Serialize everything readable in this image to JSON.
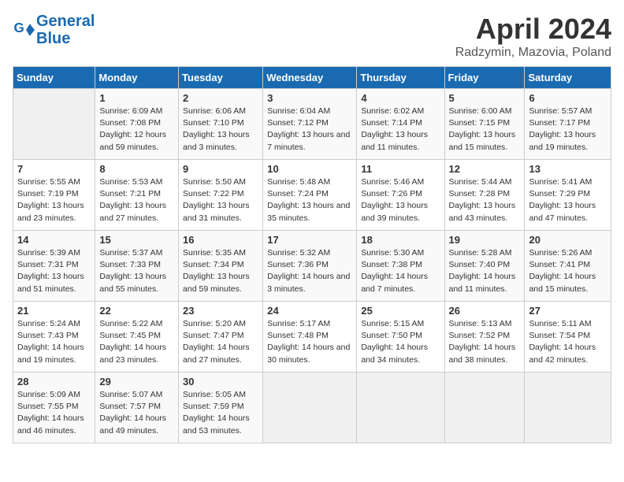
{
  "logo": {
    "line1": "General",
    "line2": "Blue"
  },
  "title": "April 2024",
  "subtitle": "Radzymin, Mazovia, Poland",
  "header": {
    "days": [
      "Sunday",
      "Monday",
      "Tuesday",
      "Wednesday",
      "Thursday",
      "Friday",
      "Saturday"
    ]
  },
  "weeks": [
    [
      {
        "day": "",
        "sunrise": "",
        "sunset": "",
        "daylight": "",
        "empty": true
      },
      {
        "day": "1",
        "sunrise": "Sunrise: 6:09 AM",
        "sunset": "Sunset: 7:08 PM",
        "daylight": "Daylight: 12 hours and 59 minutes."
      },
      {
        "day": "2",
        "sunrise": "Sunrise: 6:06 AM",
        "sunset": "Sunset: 7:10 PM",
        "daylight": "Daylight: 13 hours and 3 minutes."
      },
      {
        "day": "3",
        "sunrise": "Sunrise: 6:04 AM",
        "sunset": "Sunset: 7:12 PM",
        "daylight": "Daylight: 13 hours and 7 minutes."
      },
      {
        "day": "4",
        "sunrise": "Sunrise: 6:02 AM",
        "sunset": "Sunset: 7:14 PM",
        "daylight": "Daylight: 13 hours and 11 minutes."
      },
      {
        "day": "5",
        "sunrise": "Sunrise: 6:00 AM",
        "sunset": "Sunset: 7:15 PM",
        "daylight": "Daylight: 13 hours and 15 minutes."
      },
      {
        "day": "6",
        "sunrise": "Sunrise: 5:57 AM",
        "sunset": "Sunset: 7:17 PM",
        "daylight": "Daylight: 13 hours and 19 minutes."
      }
    ],
    [
      {
        "day": "7",
        "sunrise": "Sunrise: 5:55 AM",
        "sunset": "Sunset: 7:19 PM",
        "daylight": "Daylight: 13 hours and 23 minutes."
      },
      {
        "day": "8",
        "sunrise": "Sunrise: 5:53 AM",
        "sunset": "Sunset: 7:21 PM",
        "daylight": "Daylight: 13 hours and 27 minutes."
      },
      {
        "day": "9",
        "sunrise": "Sunrise: 5:50 AM",
        "sunset": "Sunset: 7:22 PM",
        "daylight": "Daylight: 13 hours and 31 minutes."
      },
      {
        "day": "10",
        "sunrise": "Sunrise: 5:48 AM",
        "sunset": "Sunset: 7:24 PM",
        "daylight": "Daylight: 13 hours and 35 minutes."
      },
      {
        "day": "11",
        "sunrise": "Sunrise: 5:46 AM",
        "sunset": "Sunset: 7:26 PM",
        "daylight": "Daylight: 13 hours and 39 minutes."
      },
      {
        "day": "12",
        "sunrise": "Sunrise: 5:44 AM",
        "sunset": "Sunset: 7:28 PM",
        "daylight": "Daylight: 13 hours and 43 minutes."
      },
      {
        "day": "13",
        "sunrise": "Sunrise: 5:41 AM",
        "sunset": "Sunset: 7:29 PM",
        "daylight": "Daylight: 13 hours and 47 minutes."
      }
    ],
    [
      {
        "day": "14",
        "sunrise": "Sunrise: 5:39 AM",
        "sunset": "Sunset: 7:31 PM",
        "daylight": "Daylight: 13 hours and 51 minutes."
      },
      {
        "day": "15",
        "sunrise": "Sunrise: 5:37 AM",
        "sunset": "Sunset: 7:33 PM",
        "daylight": "Daylight: 13 hours and 55 minutes."
      },
      {
        "day": "16",
        "sunrise": "Sunrise: 5:35 AM",
        "sunset": "Sunset: 7:34 PM",
        "daylight": "Daylight: 13 hours and 59 minutes."
      },
      {
        "day": "17",
        "sunrise": "Sunrise: 5:32 AM",
        "sunset": "Sunset: 7:36 PM",
        "daylight": "Daylight: 14 hours and 3 minutes."
      },
      {
        "day": "18",
        "sunrise": "Sunrise: 5:30 AM",
        "sunset": "Sunset: 7:38 PM",
        "daylight": "Daylight: 14 hours and 7 minutes."
      },
      {
        "day": "19",
        "sunrise": "Sunrise: 5:28 AM",
        "sunset": "Sunset: 7:40 PM",
        "daylight": "Daylight: 14 hours and 11 minutes."
      },
      {
        "day": "20",
        "sunrise": "Sunrise: 5:26 AM",
        "sunset": "Sunset: 7:41 PM",
        "daylight": "Daylight: 14 hours and 15 minutes."
      }
    ],
    [
      {
        "day": "21",
        "sunrise": "Sunrise: 5:24 AM",
        "sunset": "Sunset: 7:43 PM",
        "daylight": "Daylight: 14 hours and 19 minutes."
      },
      {
        "day": "22",
        "sunrise": "Sunrise: 5:22 AM",
        "sunset": "Sunset: 7:45 PM",
        "daylight": "Daylight: 14 hours and 23 minutes."
      },
      {
        "day": "23",
        "sunrise": "Sunrise: 5:20 AM",
        "sunset": "Sunset: 7:47 PM",
        "daylight": "Daylight: 14 hours and 27 minutes."
      },
      {
        "day": "24",
        "sunrise": "Sunrise: 5:17 AM",
        "sunset": "Sunset: 7:48 PM",
        "daylight": "Daylight: 14 hours and 30 minutes."
      },
      {
        "day": "25",
        "sunrise": "Sunrise: 5:15 AM",
        "sunset": "Sunset: 7:50 PM",
        "daylight": "Daylight: 14 hours and 34 minutes."
      },
      {
        "day": "26",
        "sunrise": "Sunrise: 5:13 AM",
        "sunset": "Sunset: 7:52 PM",
        "daylight": "Daylight: 14 hours and 38 minutes."
      },
      {
        "day": "27",
        "sunrise": "Sunrise: 5:11 AM",
        "sunset": "Sunset: 7:54 PM",
        "daylight": "Daylight: 14 hours and 42 minutes."
      }
    ],
    [
      {
        "day": "28",
        "sunrise": "Sunrise: 5:09 AM",
        "sunset": "Sunset: 7:55 PM",
        "daylight": "Daylight: 14 hours and 46 minutes."
      },
      {
        "day": "29",
        "sunrise": "Sunrise: 5:07 AM",
        "sunset": "Sunset: 7:57 PM",
        "daylight": "Daylight: 14 hours and 49 minutes."
      },
      {
        "day": "30",
        "sunrise": "Sunrise: 5:05 AM",
        "sunset": "Sunset: 7:59 PM",
        "daylight": "Daylight: 14 hours and 53 minutes."
      },
      {
        "day": "",
        "sunrise": "",
        "sunset": "",
        "daylight": "",
        "empty": true
      },
      {
        "day": "",
        "sunrise": "",
        "sunset": "",
        "daylight": "",
        "empty": true
      },
      {
        "day": "",
        "sunrise": "",
        "sunset": "",
        "daylight": "",
        "empty": true
      },
      {
        "day": "",
        "sunrise": "",
        "sunset": "",
        "daylight": "",
        "empty": true
      }
    ]
  ]
}
